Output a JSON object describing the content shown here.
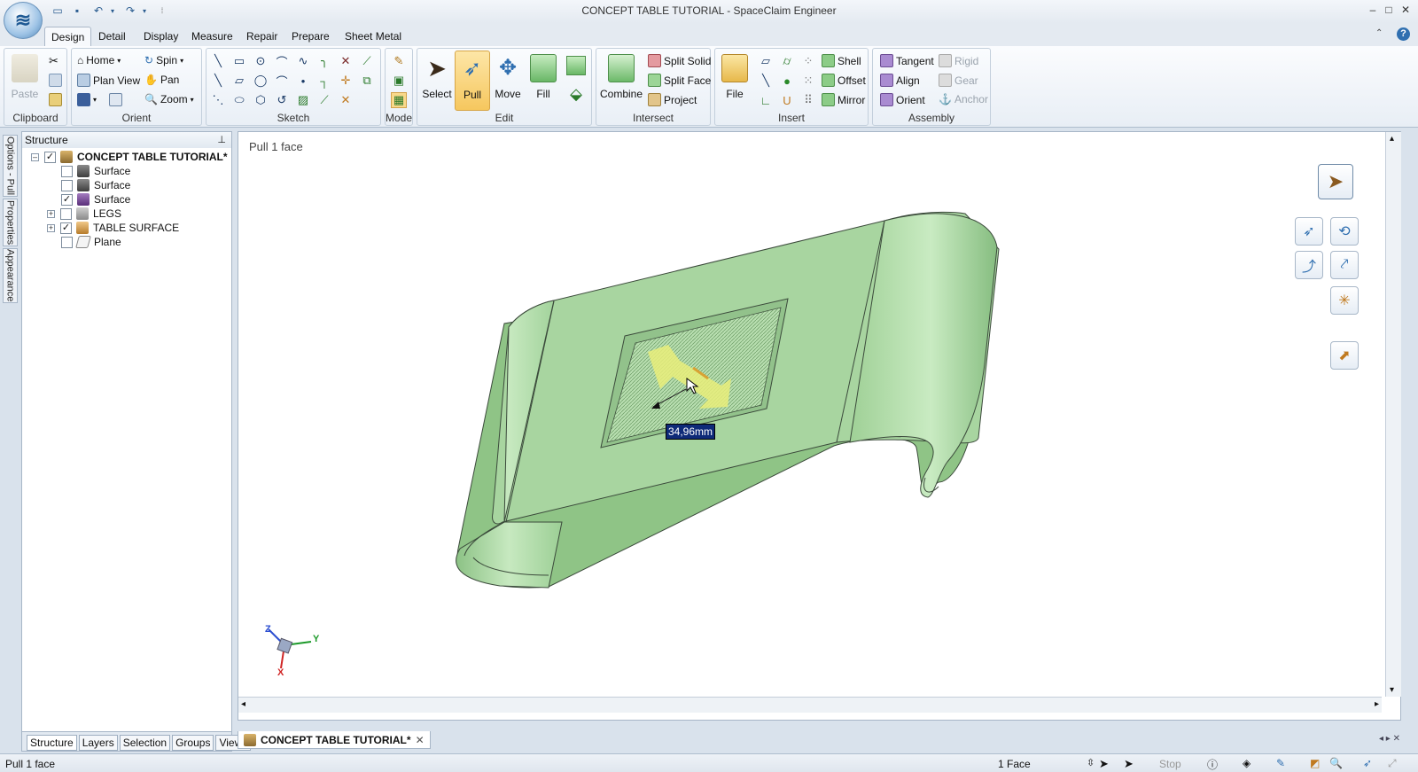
{
  "window": {
    "title": "CONCEPT TABLE TUTORIAL - SpaceClaim Engineer",
    "minimize": "–",
    "maximize": "□",
    "close": "✕"
  },
  "tabs": [
    "Design",
    "Detail",
    "Display",
    "Measure",
    "Repair",
    "Prepare",
    "Sheet Metal"
  ],
  "ribbon": {
    "clipboard": {
      "paste": "Paste",
      "title": "Clipboard"
    },
    "orient": {
      "home": "Home",
      "spin": "Spin",
      "plan_view": "Plan View",
      "pan": "Pan",
      "zoom": "Zoom",
      "title": "Orient"
    },
    "sketch": {
      "title": "Sketch"
    },
    "mode": {
      "title": "Mode"
    },
    "edit": {
      "select": "Select",
      "pull": "Pull",
      "move": "Move",
      "fill": "Fill",
      "title": "Edit"
    },
    "intersect": {
      "combine": "Combine",
      "split_solid": "Split Solid",
      "split_face": "Split Face",
      "project": "Project",
      "title": "Intersect"
    },
    "insert": {
      "file": "File",
      "shell": "Shell",
      "offset": "Offset",
      "mirror": "Mirror",
      "title": "Insert"
    },
    "assembly": {
      "tangent": "Tangent",
      "align": "Align",
      "orient": "Orient",
      "rigid": "Rigid",
      "gear": "Gear",
      "anchor": "Anchor",
      "title": "Assembly"
    }
  },
  "side_tabs": [
    "Options - Pull",
    "Properties",
    "Appearance"
  ],
  "structure": {
    "title": "Structure",
    "items": [
      {
        "label": "CONCEPT TABLE TUTORIAL*",
        "checked": true,
        "expander": "–"
      },
      {
        "label": "Surface",
        "checked": false
      },
      {
        "label": "Surface",
        "checked": false
      },
      {
        "label": "Surface",
        "checked": true
      },
      {
        "label": "LEGS",
        "checked": false,
        "expander": "+"
      },
      {
        "label": "TABLE SURFACE",
        "checked": true,
        "expander": "+"
      },
      {
        "label": "Plane",
        "checked": false
      }
    ],
    "bottom_tabs": [
      "Structure",
      "Layers",
      "Selection",
      "Groups",
      "Views"
    ]
  },
  "viewport": {
    "hint": "Pull 1 face",
    "dimension": "34,96mm",
    "axis_x": "X",
    "axis_y": "Y",
    "axis_z": "Z"
  },
  "doc_tab": {
    "label": "CONCEPT TABLE TUTORIAL*"
  },
  "status": {
    "left": "Pull 1 face",
    "selection": "1 Face",
    "stop": "Stop"
  },
  "colors": {
    "accent": "#f6c75e",
    "model": "#a8d5a0",
    "model_dark": "#7fb27b"
  }
}
